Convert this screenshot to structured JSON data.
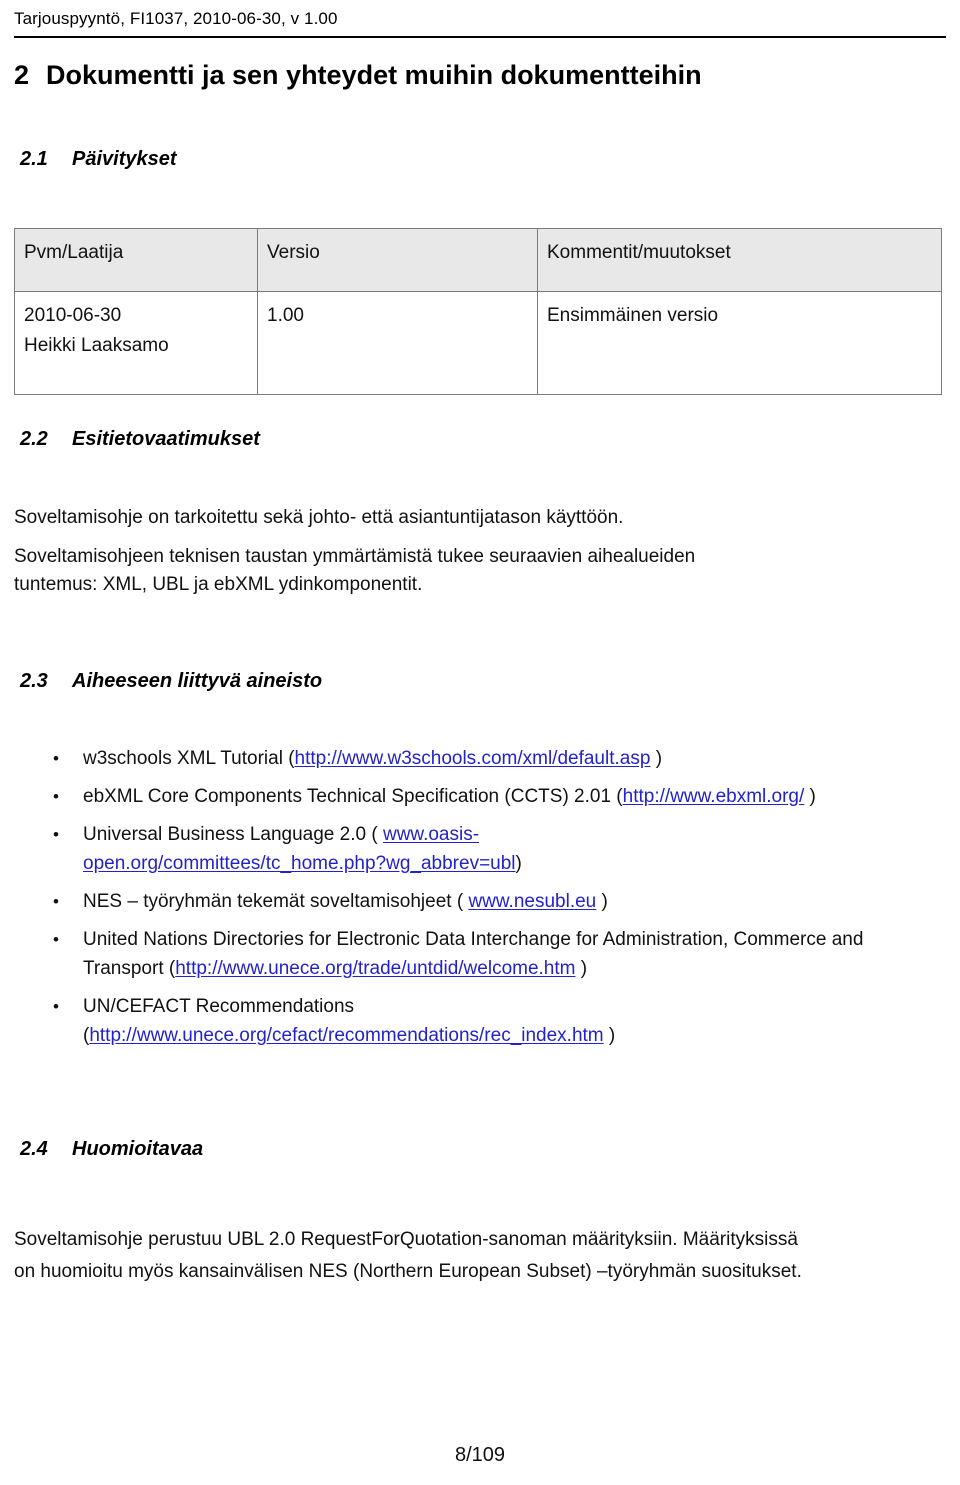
{
  "header": {
    "running_head": "Tarjouspyyntö, FI1037, 2010-06-30, v 1.00"
  },
  "headings": {
    "h1_number": "2",
    "h1_title": "Dokumentti ja sen yhteydet muihin dokumentteihin",
    "s21_number": "2.1",
    "s21_title": "Päivitykset",
    "s22_number": "2.2",
    "s22_title": "Esitietovaatimukset",
    "s23_number": "2.3",
    "s23_title": "Aiheeseen liittyvä aineisto",
    "s24_number": "2.4",
    "s24_title": "Huomioitavaa"
  },
  "revision_table": {
    "columns": [
      "Pvm/Laatija",
      "Versio",
      "Kommentit/muutokset"
    ],
    "rows": [
      {
        "date": "2010-06-30",
        "author": "Heikki Laaksamo",
        "version": "1.00",
        "comment": "Ensimmäinen versio"
      }
    ]
  },
  "section_2_2": {
    "paragraph_1": "Soveltamisohje on tarkoitettu sekä johto- että asiantuntijatason käyttöön.",
    "paragraph_2_line_1": "Soveltamisohjeen teknisen taustan ymmärtämistä tukee seuraavien aihealueiden",
    "paragraph_2_line_2": "tuntemus: XML, UBL ja ebXML ydinkomponentit."
  },
  "section_2_3": {
    "items": [
      {
        "text_before": "w3schools XML Tutorial (",
        "link": "http://www.w3schools.com/xml/default.asp",
        "text_after": " )"
      },
      {
        "text_before": "ebXML Core Components Technical Specification (CCTS) 2.01 (",
        "link": "http://www.ebxml.org/",
        "text_after": " )"
      },
      {
        "text_before": "Universal Business Language 2.0 ( ",
        "link": "www.oasis-open.org/committees/tc_home.php?wg_abbrev=ubl",
        "text_after": ")"
      },
      {
        "text_before": "NES – työryhmän tekemät soveltamisohjeet ( ",
        "link": "www.nesubl.eu",
        "text_after": " )"
      },
      {
        "text_before": "United Nations Directories for Electronic Data Interchange for Administration, Commerce and Transport (",
        "link": "http://www.unece.org/trade/untdid/welcome.htm",
        "text_after": " )"
      },
      {
        "text_before": "UN/CEFACT Recommendations (",
        "link": "http://www.unece.org/cefact/recommendations/rec_index.htm",
        "text_after": " )"
      }
    ],
    "bullet_glyph": "•"
  },
  "section_2_4": {
    "paragraph_line_1": "Soveltamisohje perustuu UBL 2.0 RequestForQuotation-sanoman määrityksiin. Määrityksissä",
    "paragraph_line_2": "on huomioitu myös kansainvälisen NES (Northern European Subset) –työryhmän suositukset."
  },
  "footer": {
    "page_number": "8/109"
  },
  "colors": {
    "link": "#2222cc",
    "table_header_bg": "#e8e8e8",
    "table_border": "#7c7c7c",
    "text": "#111111"
  }
}
